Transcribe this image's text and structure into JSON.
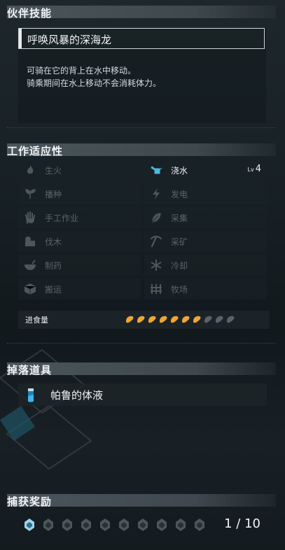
{
  "companion_skill": {
    "section_title": "伙伴技能",
    "name": "呼唤风暴的深海龙",
    "description_line1": "可骑在它的背上在水中移动。",
    "description_line2": "骑乘期间在水上移动不会消耗体力。"
  },
  "work_suitability": {
    "section_title": "工作适应性",
    "items": [
      {
        "label": "生火",
        "icon": "fire-icon",
        "active": false
      },
      {
        "label": "浇水",
        "icon": "watering-can-icon",
        "active": true,
        "level_prefix": "Lv",
        "level": "4"
      },
      {
        "label": "播种",
        "icon": "sprout-icon",
        "active": false
      },
      {
        "label": "发电",
        "icon": "lightning-icon",
        "active": false
      },
      {
        "label": "手工作业",
        "icon": "hand-icon",
        "active": false
      },
      {
        "label": "采集",
        "icon": "leaf-icon",
        "active": false
      },
      {
        "label": "伐木",
        "icon": "log-icon",
        "active": false
      },
      {
        "label": "采矿",
        "icon": "pickaxe-icon",
        "active": false
      },
      {
        "label": "制药",
        "icon": "bowl-icon",
        "active": false
      },
      {
        "label": "冷却",
        "icon": "snowflake-icon",
        "active": false
      },
      {
        "label": "搬运",
        "icon": "box-icon",
        "active": false
      },
      {
        "label": "牧场",
        "icon": "ranch-icon",
        "active": false
      }
    ]
  },
  "food": {
    "label": "进食量",
    "filled": 7,
    "total": 10,
    "filled_color": "#f0a536",
    "empty_color": "#5b6368"
  },
  "drops": {
    "section_title": "掉落道具",
    "items": [
      {
        "name": "帕鲁的体液",
        "icon": "vial-icon"
      }
    ]
  },
  "capture_bonus": {
    "section_title": "捕获奖励",
    "count_text": "1 / 10",
    "filled": 1,
    "total": 10,
    "active_color": "#9fd3ea",
    "inactive_color": "#4d565b"
  },
  "colors": {
    "accent": "#4fb8e0",
    "inactive_text": "#5a6468"
  }
}
